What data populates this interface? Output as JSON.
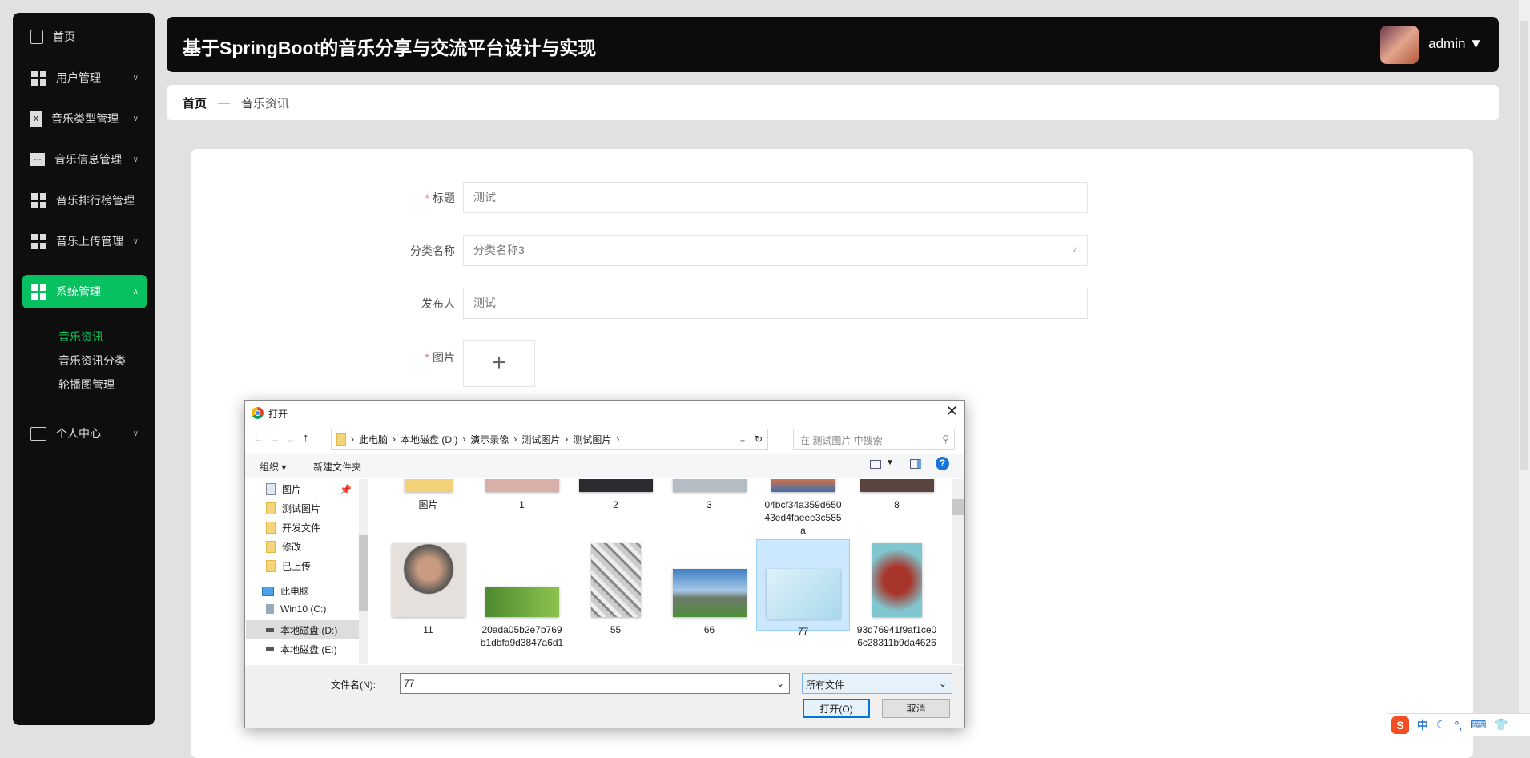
{
  "sidebar": {
    "items": [
      {
        "label": "首页",
        "icon": "home-icon"
      },
      {
        "label": "用户管理",
        "icon": "grid-icon"
      },
      {
        "label": "音乐类型管理",
        "icon": "clipboard-icon"
      },
      {
        "label": "音乐信息管理",
        "icon": "chat-icon"
      },
      {
        "label": "音乐排行榜管理",
        "icon": "grid-icon"
      },
      {
        "label": "音乐上传管理",
        "icon": "grid-icon"
      },
      {
        "label": "系统管理",
        "icon": "grid-icon"
      },
      {
        "label": "个人中心",
        "icon": "card-icon"
      }
    ],
    "sub_items": [
      "音乐资讯",
      "音乐资讯分类",
      "轮播图管理"
    ]
  },
  "header": {
    "title": "基于SpringBoot的音乐分享与交流平台设计与实现",
    "user": "admin"
  },
  "breadcrumb": {
    "home": "首页",
    "sep": "—",
    "current": "音乐资讯"
  },
  "form": {
    "title_label": "标题",
    "title_value": "测试",
    "category_label": "分类名称",
    "category_value": "分类名称3",
    "publisher_label": "发布人",
    "publisher_value": "测试",
    "image_label": "图片",
    "required": "*"
  },
  "dialog": {
    "title": "打开",
    "path": [
      "此电脑",
      "本地磁盘 (D:)",
      "演示录像",
      "测试图片",
      "测试图片"
    ],
    "search_placeholder": "在 测试图片 中搜索",
    "organize": "组织 ▾",
    "new_folder": "新建文件夹",
    "nav": [
      "图片",
      "测试图片",
      "开发文件",
      "修改",
      "已上传",
      "此电脑",
      "Win10 (C:)",
      "本地磁盘 (D:)",
      "本地磁盘 (E:)"
    ],
    "files_row1": [
      "图片",
      "1",
      "2",
      "3",
      "04bcf34a359d65043ed4faeee3c585a",
      "8"
    ],
    "files_row2": [
      "11",
      "20ada05b2e7b769b1dbfa9d3847a6d1",
      "55",
      "66",
      "77",
      "93d76941f9af1ce06c28311b9da4626"
    ],
    "filename_label": "文件名(N):",
    "filename_value": "77",
    "filter": "所有文件",
    "open": "打开(O)",
    "cancel": "取消"
  },
  "tray": {
    "ime": "S",
    "lang": "中"
  }
}
